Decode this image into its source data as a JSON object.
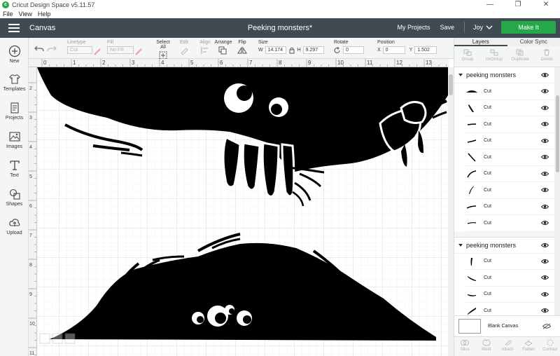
{
  "window": {
    "title": "Cricut Design Space  v5.11.57",
    "controls": [
      "—",
      "❐",
      "✕"
    ]
  },
  "menu": [
    "File",
    "View",
    "Help"
  ],
  "appbar": {
    "section": "Canvas",
    "project_title": "Peeking monsters*",
    "my_projects": "My Projects",
    "save": "Save",
    "user": "Joy",
    "make_it": "Make It"
  },
  "toolbar": {
    "linetype_label": "Linetype",
    "linetype_value": "Cut",
    "fill_label": "Fill",
    "fill_value": "No Fill",
    "select_all": "Select All",
    "edit": "Edit",
    "align": "Align",
    "arrange": "Arrange",
    "flip": "Flip",
    "size_label": "Size",
    "w_label": "W",
    "w_value": "14.174",
    "h_label": "H",
    "h_value": "9.297",
    "rotate_label": "Rotate",
    "rotate_value": "0",
    "position_label": "Position",
    "x_label": "X",
    "x_value": "0",
    "y_label": "Y",
    "y_value": "1.502"
  },
  "leftbar": [
    {
      "label": "New",
      "icon": "plus-circle-icon"
    },
    {
      "label": "Templates",
      "icon": "tshirt-icon"
    },
    {
      "label": "Projects",
      "icon": "projects-icon"
    },
    {
      "label": "Images",
      "icon": "image-icon"
    },
    {
      "label": "Text",
      "icon": "text-icon"
    },
    {
      "label": "Shapes",
      "icon": "shapes-icon"
    },
    {
      "label": "Upload",
      "icon": "upload-cloud-icon"
    }
  ],
  "ruler": {
    "h_ticks": [
      "0",
      "1",
      "2",
      "3",
      "4",
      "5",
      "6",
      "7",
      "8",
      "9",
      "10",
      "11",
      "12",
      "13"
    ],
    "v_ticks": [
      "2",
      "3",
      "4",
      "5",
      "6",
      "7",
      "8",
      "9",
      "10",
      "11"
    ]
  },
  "panel": {
    "tabs": [
      "Layers",
      "Color Sync"
    ],
    "tools": [
      "Group",
      "UnGroup",
      "Duplicate",
      "Delete"
    ],
    "groups": [
      {
        "name": "peeking monsters",
        "layers": [
          "Cut",
          "Cut",
          "Cut",
          "Cut",
          "Cut",
          "Cut",
          "Cut",
          "Cut",
          "Cut"
        ]
      },
      {
        "name": "peeking monsters",
        "layers": [
          "Cut",
          "Cut",
          "Cut",
          "Cut"
        ]
      }
    ],
    "blank_canvas": "Blank Canvas",
    "bottom_tools": [
      "Slice",
      "Weld",
      "Attach",
      "Flatten",
      "Contour"
    ]
  },
  "colors": {
    "appbar": "#3f4a52",
    "make_it": "#24a84a",
    "grid": "#d9dcdc"
  }
}
